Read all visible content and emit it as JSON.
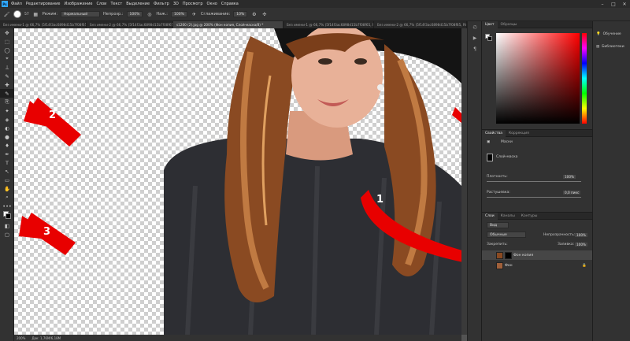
{
  "app": {
    "logo": "Ps"
  },
  "menu": [
    "Файл",
    "Редактирование",
    "Изображение",
    "Слои",
    "Текст",
    "Выделение",
    "Фильтр",
    "3D",
    "Просмотр",
    "Окно",
    "Справка"
  ],
  "window_controls": [
    "–",
    "□",
    "✕"
  ],
  "options": {
    "brush_size": "57",
    "mode_label": "Режим:",
    "mode_value": "Нормальный",
    "opacity_label": "Непрозр.:",
    "opacity_value": "100%",
    "flow_label": "Наж.:",
    "flow_value": "100%",
    "smoothing_label": "Сглаживание:",
    "smoothing_value": "10%"
  },
  "tabs": [
    {
      "label": "Без имени-1 @ 66,7% (5f14f3ac6898d15b7f08f65, RGB/8...",
      "active": false
    },
    {
      "label": "Без имени-2 @ 66,7% (5f14f3ac6898d15b7f08f65, RGB/8...",
      "active": false
    },
    {
      "label": "s1200 (2).jpg @ 200% (Фон копия, Слой-маска/8) *",
      "active": true
    },
    {
      "label": "Без имени-1 @ 66,7% (5f14f3ac6898d15b7f08f65, RGB/8...",
      "active": false
    },
    {
      "label": "Без имени-2 @ 66,7% (5f14f3ac6898d15b7f08f65, RGB/8...",
      "active": false
    }
  ],
  "tools": [
    "✥",
    "⬚",
    "◯",
    "⌖",
    "⟂",
    "✎",
    "✚",
    "✎",
    "⎘",
    "✦",
    "◈",
    "◐",
    "●",
    "♦",
    "✒",
    "T",
    "↖",
    "▭",
    "✋",
    "⌕",
    "•••",
    "▣",
    "◧",
    "▢"
  ],
  "status": {
    "zoom": "200%",
    "doc": "Док: 1,76M/6,18M"
  },
  "color_panel": {
    "tabs": [
      "Цвет",
      "Образцы"
    ]
  },
  "properties": {
    "tabs": [
      "Свойства",
      "Коррекция"
    ],
    "title": "Маски",
    "mask_label": "Слой-маска",
    "density_label": "Плотность:",
    "density_value": "100%",
    "feather_label": "Растушевка:",
    "feather_value": "0,0 пикс"
  },
  "layers": {
    "tabs": [
      "Слои",
      "Каналы",
      "Контуры"
    ],
    "filter_label": "Вид",
    "blend": "Обычные",
    "opacity_label": "Непрозрачность:",
    "opacity_value": "100%",
    "lock_label": "Закрепить:",
    "fill_label": "Заливка:",
    "fill_value": "100%",
    "items": [
      {
        "name": "Фон копия",
        "selected": true
      },
      {
        "name": "Фон",
        "selected": false
      }
    ]
  },
  "right_dock": [
    {
      "icon": "lightbulb-icon",
      "label": "Обучение"
    },
    {
      "icon": "library-icon",
      "label": "Библиотеки"
    }
  ],
  "annotations": [
    "1",
    "2",
    "3"
  ],
  "colors": {
    "accent": "#31a8ff",
    "arrow": "#e80000"
  }
}
